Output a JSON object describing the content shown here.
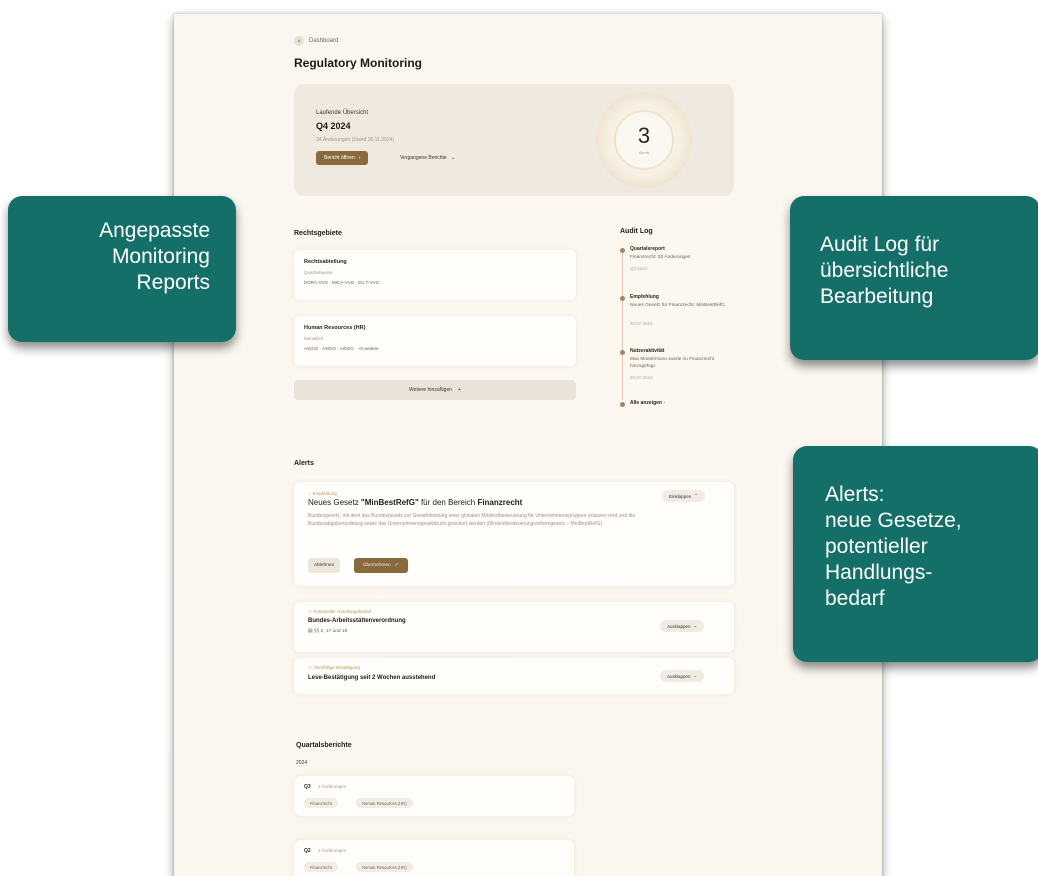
{
  "nav": {
    "back_label": "Dashboard",
    "back_icon": "chevron-left-icon"
  },
  "page_title": "Regulatory Monitoring",
  "overview": {
    "label": "Laufende Übersicht",
    "quarter": "Q4 2024",
    "subtitle": "34 Änderungen (Stand 20.11.2024)",
    "open_button": "Bericht öffnen",
    "past_button": "Vergangene Berichte",
    "count": "3",
    "count_caption": "Alerts"
  },
  "areas": {
    "heading": "Rechtsgebiete",
    "items": [
      {
        "title": "Rechtsabteilung",
        "subtitle": "Quartalsweise",
        "codes": "DORA-VVG · MICA-VVG · EU T-VVG"
      },
      {
        "title": "Human Resources (HR)",
        "subtitle": "Monatlich",
        "codes": "ASchG · ASiGG · ArbGG · +5 weitere"
      }
    ],
    "add_button": "Weitere hinzufügen",
    "add_icon": "+"
  },
  "audit": {
    "heading": "Audit Log",
    "items": [
      {
        "title": "Quartalsreport",
        "desc": "Finanzrecht: 33 Änderungen",
        "date": "Q3 2024"
      },
      {
        "title": "Empfehlung",
        "desc": "Neues Gesetz für Finanzrecht: MinBestRefG",
        "date": "20.07.2024"
      },
      {
        "title": "Nutzeraktivität",
        "desc": "Max Mustermann wurde zu Finanzrecht hinzugefügt",
        "date": "20.07.2024"
      }
    ],
    "show_all": "Alle anzeigen"
  },
  "alerts": {
    "heading": "Alerts",
    "items": [
      {
        "tag": "Empfehlung",
        "title_prefix": "Neues Gesetz ",
        "title_law": "\"MinBestRefG\"",
        "title_mid": " für den Bereich ",
        "title_area": "Finanzrecht",
        "body": "Bundesgesetz, mit dem das Bundesgesetz zur Gewährleistung einer globalen Mindestbesteuerung für Unternehmensgruppen erlassen wird und die Bundesabgabenordnung sowie das Unternehmensgesetzbuch geändert werden (Mindestbesteuerungsreformgesetz – MinBestRefG)",
        "toggle": "Einklappen",
        "decline": "Ablehnen",
        "accept": "Übernehmen"
      },
      {
        "tag": "Potentieller Handlungsbedarf",
        "title": "Bundes-Arbeitsstättenverordnung",
        "meta": "§§ 2, 17 und 18",
        "toggle": "Ausklappen"
      },
      {
        "tag": "Überfällige Bestätigung",
        "title": "Lese-Bestätigung seit 2 Wochen ausstehend",
        "toggle": "Ausklappen"
      }
    ]
  },
  "quarterly": {
    "heading": "Quartalsberichte",
    "year": "2024",
    "items": [
      {
        "q": "Q3",
        "count": "3 Änderungen",
        "chips": [
          "Finanzrecht",
          "Human Resources (HR)"
        ]
      },
      {
        "q": "Q2",
        "count": "3 Änderungen",
        "chips": [
          "Finanzrecht",
          "Human Resources (HR)"
        ]
      }
    ]
  },
  "callouts": {
    "left": [
      "Angepasste",
      "Monitoring",
      "Reports"
    ],
    "right_top": [
      "Audit Log für",
      "übersichtliche",
      "Bearbeitung"
    ],
    "right_bottom": [
      "Alerts:",
      "neue Gesetze,",
      "potentieller",
      "Handlungs-",
      "bedarf"
    ]
  },
  "colors": {
    "accent": "#8a6a3d",
    "callout": "#146f69",
    "background": "#fbf7f0"
  }
}
